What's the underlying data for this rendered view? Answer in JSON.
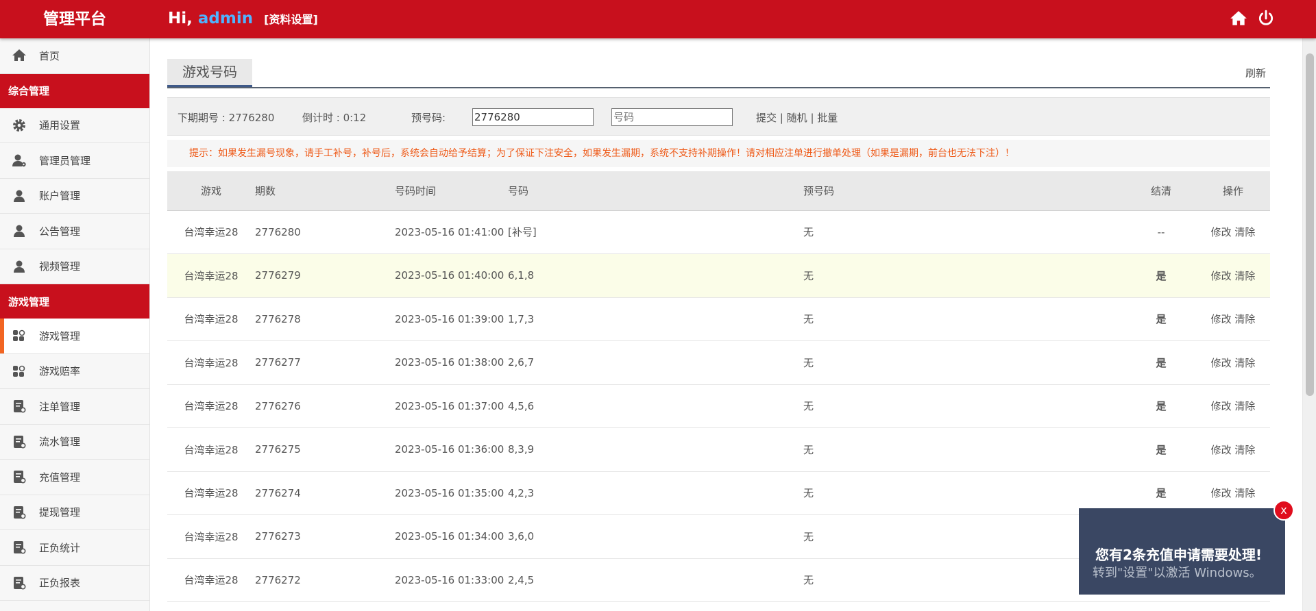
{
  "header": {
    "brand": "管理平台",
    "greeting": "Hi,",
    "username": "admin",
    "profile_link": "[资料设置]",
    "icons": [
      "home-icon",
      "power-icon"
    ]
  },
  "sidebar": {
    "home": "首页",
    "group1": "综合管理",
    "group1_items": [
      "通用设置",
      "管理员管理",
      "账户管理",
      "公告管理",
      "视频管理"
    ],
    "group2": "游戏管理",
    "group2_items": [
      "游戏管理",
      "游戏赔率",
      "注单管理",
      "流水管理",
      "充值管理",
      "提现管理",
      "正负统计",
      "正负报表"
    ]
  },
  "main": {
    "tab": "游戏号码",
    "refresh": "刷新",
    "form": {
      "next_issue": "下期期号 : 2776280",
      "countdown": "倒计时 : 0:12",
      "pre_label": "预号码:",
      "issue_value": "2776280",
      "number_placeholder": "号码",
      "submit": "提交",
      "random": "随机",
      "batch": "批量",
      "sep": "|"
    },
    "notice": "提示：如果发生漏号现象，请手工补号，补号后，系统会自动给予结算；为了保证下注安全，如果发生漏期，系统不支持补期操作！请对相应注单进行撤单处理（如果是漏期，前台也无法下注）！",
    "columns": [
      "游戏",
      "期数",
      "号码时间",
      "号码",
      "预号码",
      "结清",
      "操作"
    ],
    "rows": [
      {
        "game": "台湾幸运28",
        "issue": "2776280",
        "time": "2023-05-16 01:41:00",
        "number": "[补号]",
        "pre": "无",
        "settled": "--",
        "edit": "修改",
        "clear": "清除"
      },
      {
        "game": "台湾幸运28",
        "issue": "2776279",
        "time": "2023-05-16 01:40:00",
        "number": "6,1,8",
        "pre": "无",
        "settled": "是",
        "edit": "修改",
        "clear": "清除"
      },
      {
        "game": "台湾幸运28",
        "issue": "2776278",
        "time": "2023-05-16 01:39:00",
        "number": "1,7,3",
        "pre": "无",
        "settled": "是",
        "edit": "修改",
        "clear": "清除"
      },
      {
        "game": "台湾幸运28",
        "issue": "2776277",
        "time": "2023-05-16 01:38:00",
        "number": "2,6,7",
        "pre": "无",
        "settled": "是",
        "edit": "修改",
        "clear": "清除"
      },
      {
        "game": "台湾幸运28",
        "issue": "2776276",
        "time": "2023-05-16 01:37:00",
        "number": "4,5,6",
        "pre": "无",
        "settled": "是",
        "edit": "修改",
        "clear": "清除"
      },
      {
        "game": "台湾幸运28",
        "issue": "2776275",
        "time": "2023-05-16 01:36:00",
        "number": "8,3,9",
        "pre": "无",
        "settled": "是",
        "edit": "修改",
        "clear": "清除"
      },
      {
        "game": "台湾幸运28",
        "issue": "2776274",
        "time": "2023-05-16 01:35:00",
        "number": "4,2,3",
        "pre": "无",
        "settled": "是",
        "edit": "修改",
        "clear": "清除"
      },
      {
        "game": "台湾幸运28",
        "issue": "2776273",
        "time": "2023-05-16 01:34:00",
        "number": "3,6,0",
        "pre": "无",
        "settled": "",
        "edit": "",
        "clear": ""
      },
      {
        "game": "台湾幸运28",
        "issue": "2776272",
        "time": "2023-05-16 01:33:00",
        "number": "2,4,5",
        "pre": "无",
        "settled": "",
        "edit": "",
        "clear": ""
      }
    ]
  },
  "toast": {
    "message": "您有2条充值申请需要处理!",
    "watermark": "转到\"设置\"以激活 Windows。",
    "close": "x"
  },
  "colors": {
    "brand_red": "#c8101d",
    "accent_orange": "#f26522",
    "link_blue": "#2d6fd6",
    "notice_orange": "#ee5a18",
    "toast_bg": "#3a4763"
  }
}
